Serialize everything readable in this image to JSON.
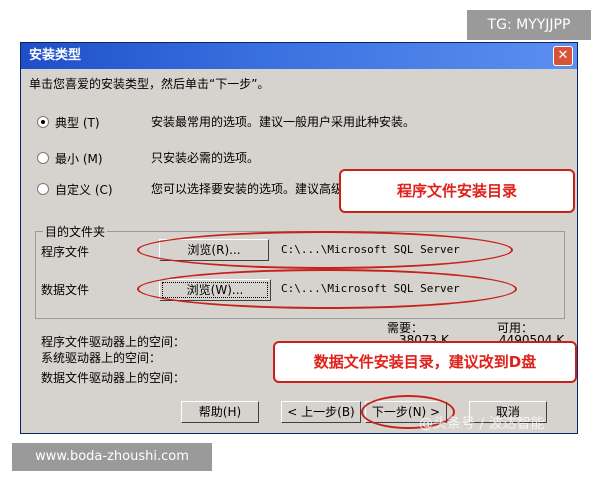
{
  "dialog": {
    "title": "安装类型",
    "close_glyph": "✕",
    "instruction": "单击您喜爱的安装类型，然后单击“下一步”。"
  },
  "options": [
    {
      "label": "典型",
      "hotkey": "(T)",
      "description": "安装最常用的选项。建议一般用户采用此种安装。",
      "selected": true
    },
    {
      "label": "最小",
      "hotkey": "(M)",
      "description": "只安装必需的选项。",
      "selected": false
    },
    {
      "label": "自定义",
      "hotkey": "(C)",
      "description": "您可以选择要安装的选项。建议高级用户采用此种安装",
      "selected": false
    }
  ],
  "destination": {
    "group_label": "目的文件夹",
    "program_label": "程序文件",
    "program_browse": "浏览(R)...",
    "program_path": "C:\\...\\Microsoft SQL Server",
    "data_label": "数据文件",
    "data_browse": "浏览(W)...",
    "data_path": "C:\\...\\Microsoft SQL Server"
  },
  "space": {
    "required_header": "需要：",
    "available_header": "可用：",
    "rows": [
      {
        "label": "程序文件驱动器上的空间：",
        "required": "38073 K",
        "available": "4490504 K"
      },
      {
        "label": "系统驱动器上的空间：",
        "required": "",
        "available": ""
      },
      {
        "label": "数据文件驱动器上的空间：",
        "required": "",
        "available": ""
      }
    ]
  },
  "buttons": {
    "help": "帮助(H)",
    "back": "< 上一步(B)",
    "next": "下一步(N) >",
    "cancel": "取消"
  },
  "annotations": {
    "program_callout": "程序文件安装目录",
    "data_callout": "数据文件安装目录，建议改到D盘"
  },
  "watermarks": {
    "tg": "TG: MYYJJPP",
    "url": "www.boda-zhoushi.com",
    "faint": "@头条号 / 波达智能"
  },
  "colors": {
    "title_bar": "#1f4fc8",
    "dialog_bg": "#d6d3ce",
    "annotation_red": "#e0201a"
  }
}
